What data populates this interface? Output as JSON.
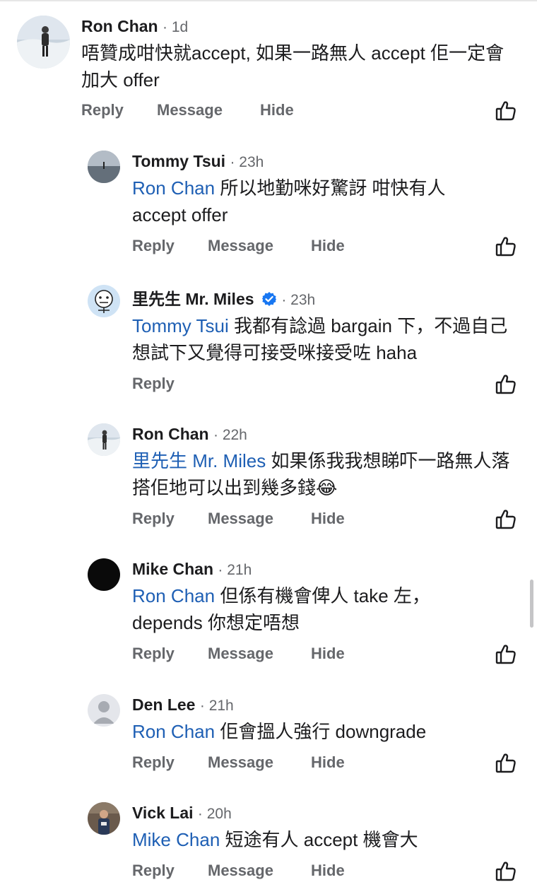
{
  "actions": {
    "reply": "Reply",
    "message": "Message",
    "hide": "Hide"
  },
  "comments": [
    {
      "name": "Ron Chan",
      "time": "1d",
      "text": "唔贊成咁快就accept, 如果一路無人 accept 佢一定會加大 offer"
    },
    {
      "name": "Tommy Tsui",
      "time": "23h",
      "mention": "Ron Chan",
      "text": "所以地勤咪好驚訝 咁快有人 accept offer"
    },
    {
      "name": "里先生 Mr. Miles",
      "verified": true,
      "time": "23h",
      "mention": "Tommy Tsui",
      "text": "我都有諗過 bargain 下，不過自己想試下又覺得可接受咪接受咗 haha"
    },
    {
      "name": "Ron Chan",
      "time": "22h",
      "mention": "里先生 Mr. Miles",
      "text": "如果係我我想睇吓一路無人落搭佢地可以出到幾多錢",
      "emoji": "😂"
    },
    {
      "name": "Mike Chan",
      "time": "21h",
      "mention": "Ron Chan",
      "text": "但係有機會俾人 take 左，depends 你想定唔想"
    },
    {
      "name": "Den Lee",
      "time": "21h",
      "mention": "Ron Chan",
      "text": "佢會搵人強行 downgrade"
    },
    {
      "name": "Vick Lai",
      "time": "20h",
      "mention": "Mike Chan",
      "text": "短途有人 accept 機會大"
    }
  ],
  "colors": {
    "mention": "#1e5fb4",
    "verified_badge": "#1877f2",
    "secondary_text": "#65676b"
  },
  "icons": {
    "like": "thumbs-up-outline-icon",
    "verified": "verified-badge-icon",
    "scroll": "scrollbar-thumb"
  }
}
